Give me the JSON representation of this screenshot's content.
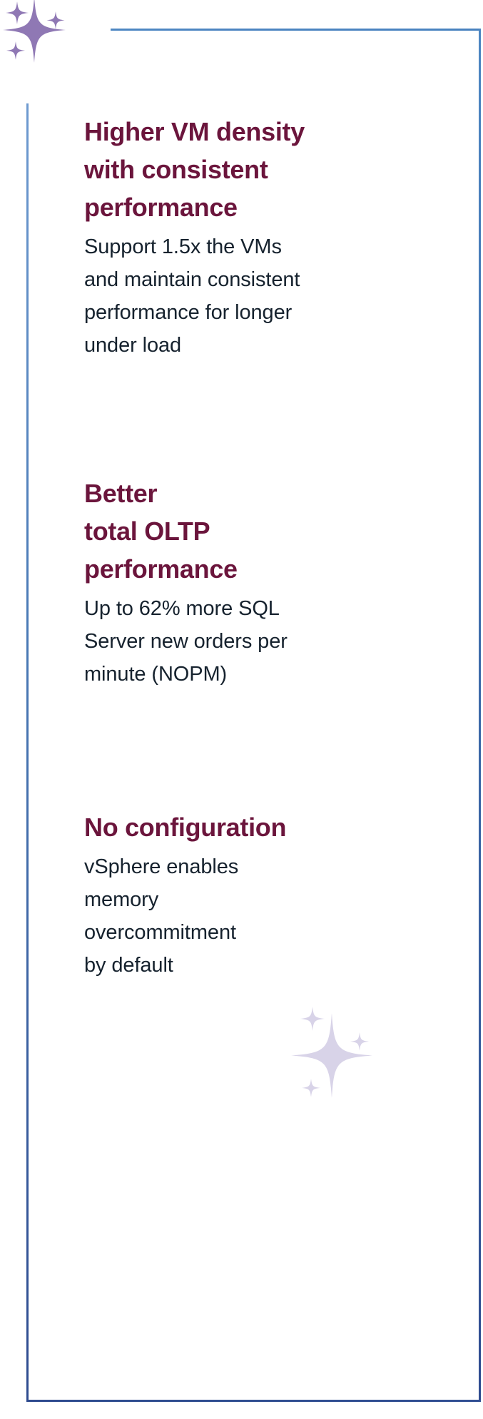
{
  "theme": {
    "background_color": "#ffffff",
    "heading_color": "#6b153c",
    "body_color": "#16222e",
    "frame_color_top": "#4d86c2",
    "frame_color_bottom": "#2e4b8f",
    "sparkle_color_primary": "#8f78b4",
    "sparkle_color_secondary": "#d8d3e8"
  },
  "decorations": {
    "top_left_sparkle": "sparkle-cluster-icon",
    "bottom_right_sparkle": "sparkle-cluster-icon",
    "frame": "rectangular-border"
  },
  "blocks": [
    {
      "heading": "Higher VM density\nwith consistent\nperformance",
      "body": "Support 1.5x the VMs\nand maintain consistent\nperformance for longer\nunder load"
    },
    {
      "heading": "Better\ntotal OLTP\nperformance",
      "body": "Up to 62% more SQL\nServer new orders per\nminute (NOPM)"
    },
    {
      "heading": "No configuration",
      "body": "vSphere enables\nmemory\novercommitment\nby default"
    }
  ]
}
